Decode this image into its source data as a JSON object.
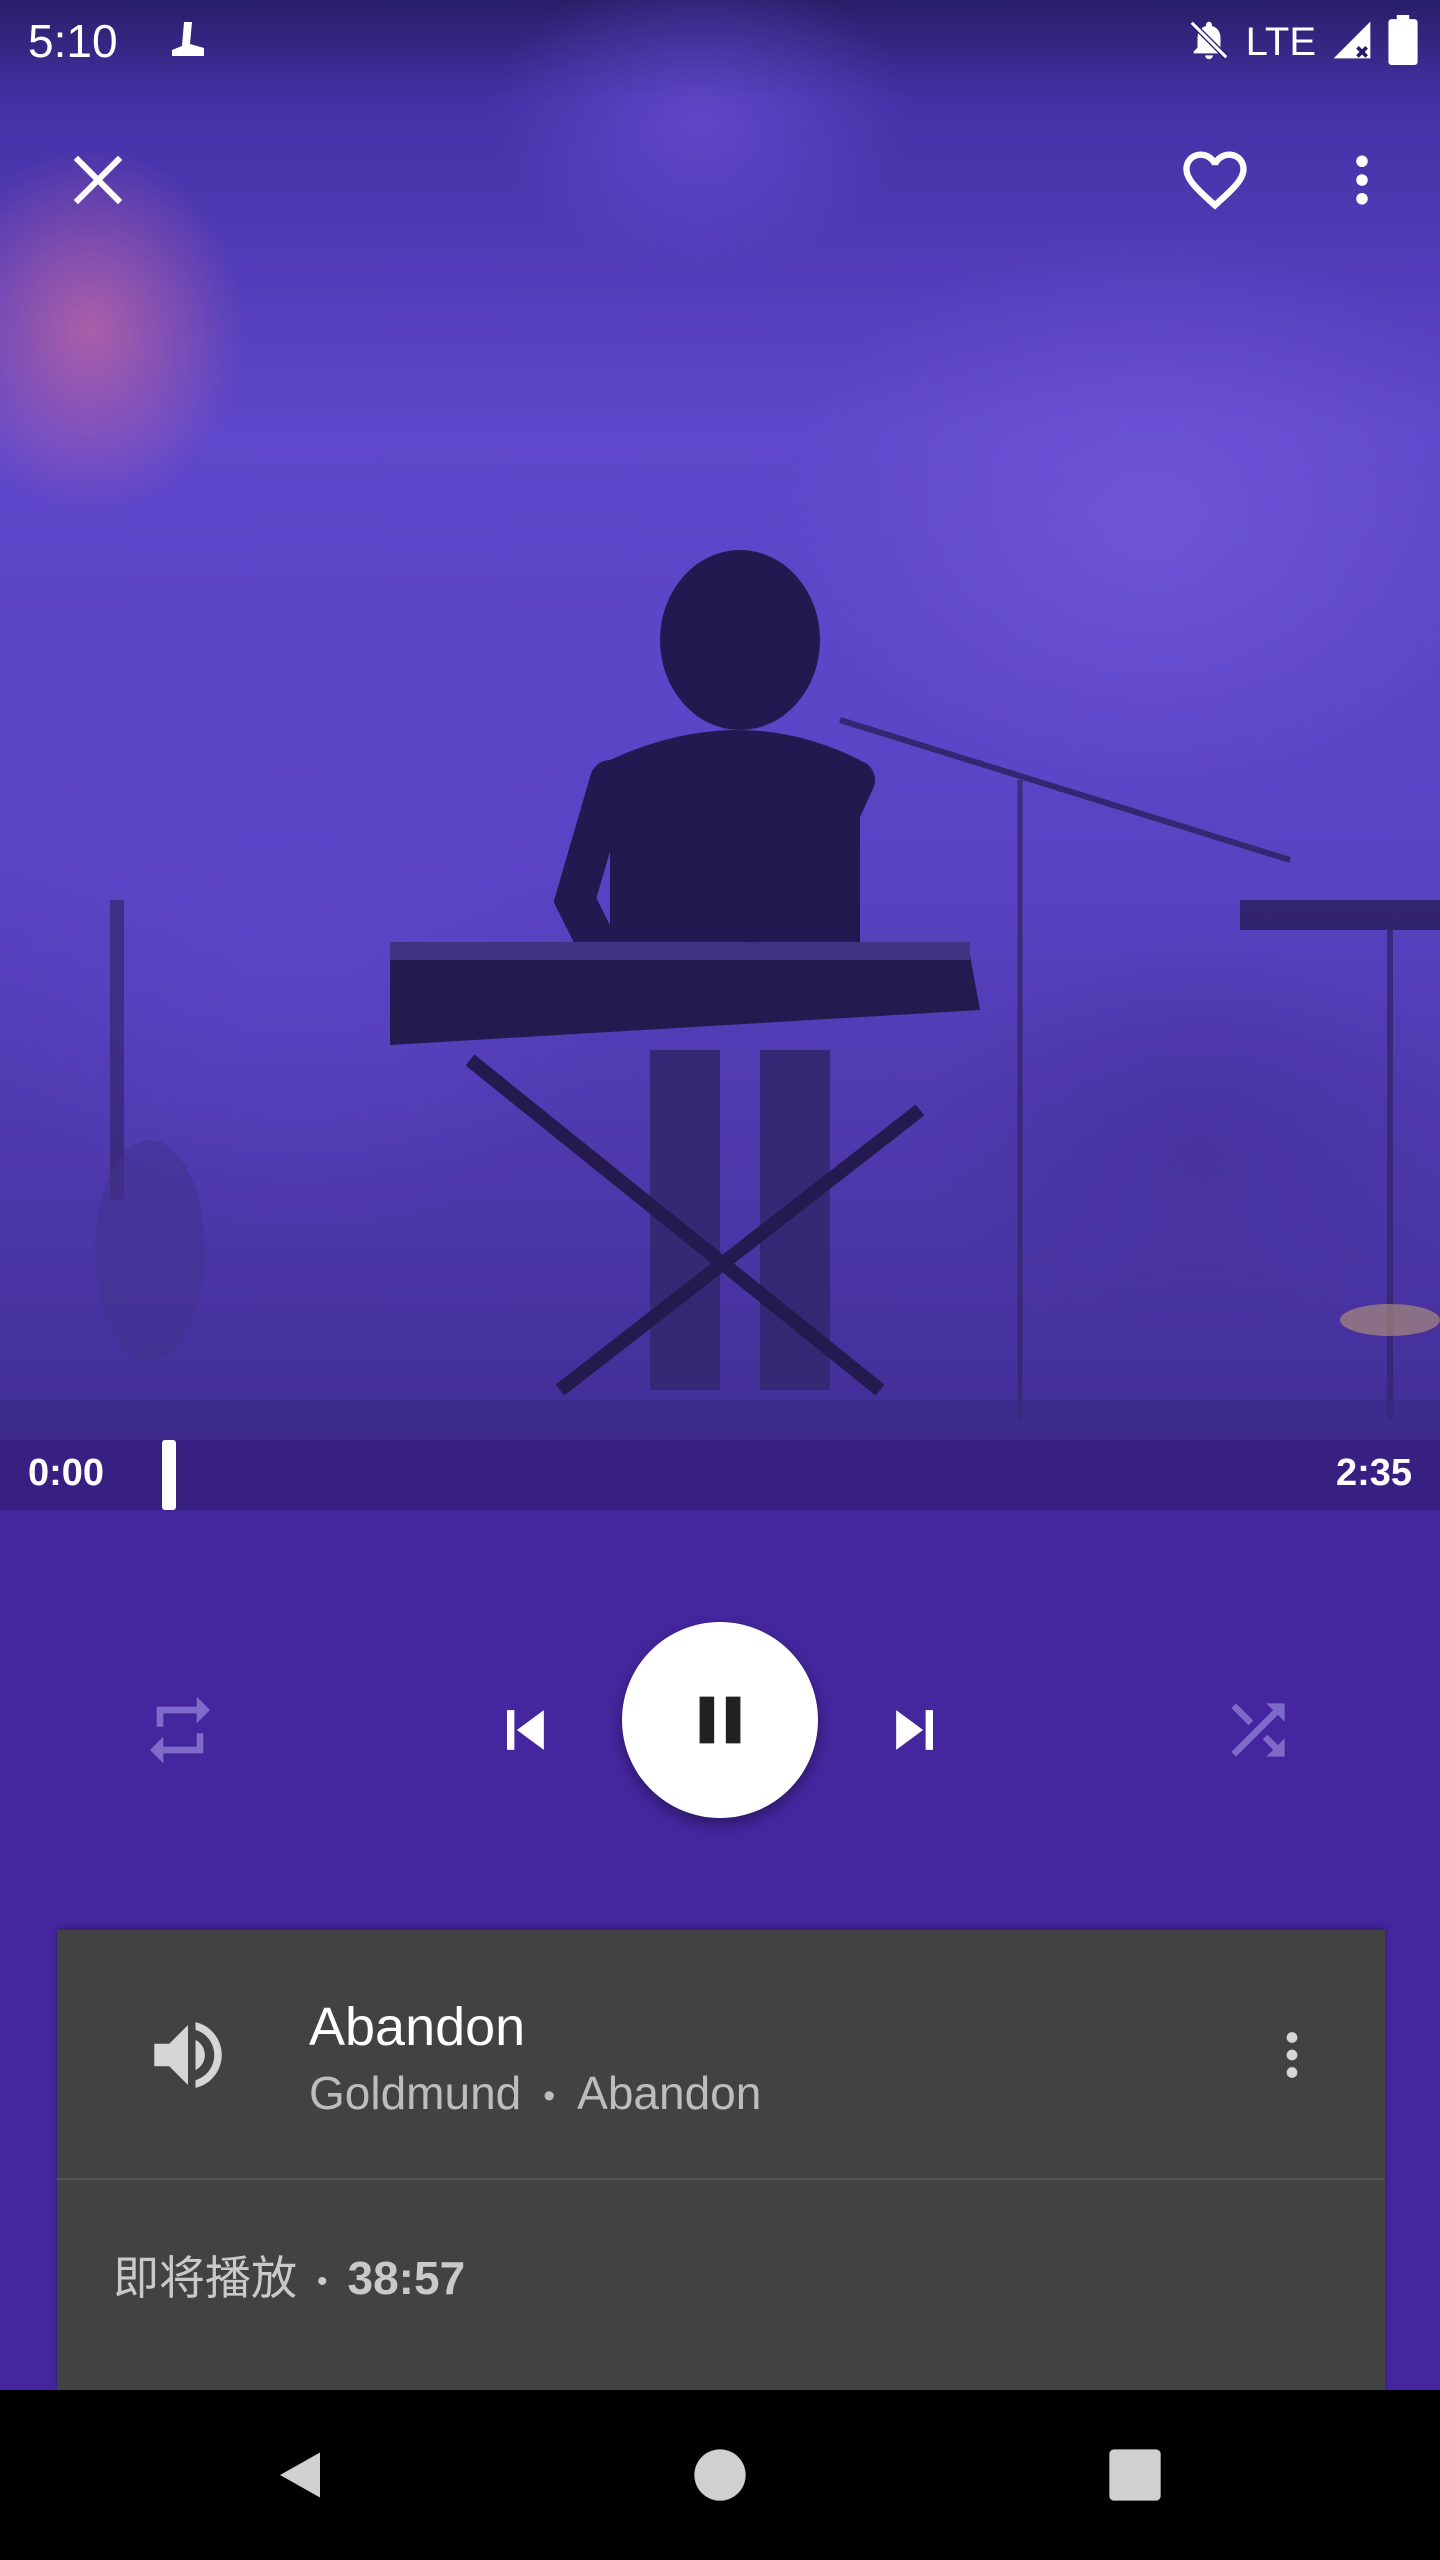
{
  "status_bar": {
    "time": "5:10",
    "network": "LTE",
    "icons": [
      "app-notification-icon",
      "notifications-off-icon",
      "signal-icon",
      "battery-icon"
    ]
  },
  "header": {
    "icons": [
      "close-icon",
      "heart-outline-icon",
      "more-vert-icon"
    ]
  },
  "playback": {
    "elapsed": "0:00",
    "total": "2:35",
    "progress_fraction": 0.0,
    "state": "playing"
  },
  "controls": {
    "icons": [
      "repeat-icon",
      "skip-previous-icon",
      "pause-icon",
      "skip-next-icon",
      "shuffle-icon"
    ]
  },
  "now_playing": {
    "title": "Abandon",
    "artist": "Goldmund",
    "separator": "•",
    "album": "Abandon"
  },
  "up_next": {
    "label": "即将播放",
    "separator": "•",
    "duration": "38:57"
  },
  "nav_bar": {
    "icons": [
      "back-icon",
      "home-icon",
      "recents-icon"
    ]
  },
  "colors": {
    "controls_bg": "#44269e",
    "progress_bg": "#381f82",
    "card_bg": "#424242",
    "accent": "#ffffff"
  }
}
